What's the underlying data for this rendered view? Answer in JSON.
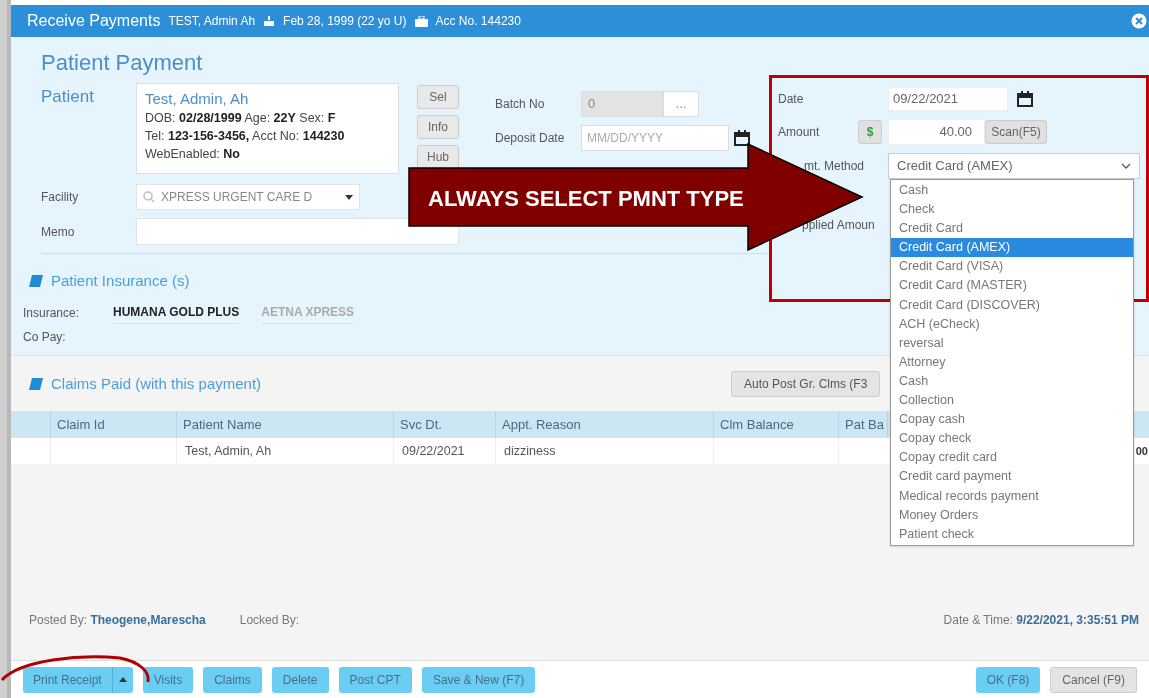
{
  "title_bar": {
    "title": "Receive Payments",
    "patient": "TEST, Admin Ah",
    "dob": "Feb 28, 1999 (22 yo U)",
    "account": "Acc No. 144230"
  },
  "heading": "Patient Payment",
  "patient": {
    "label": "Patient",
    "name": "Test, Admin, Ah",
    "lines": [
      "DOB: **02/28/1999** Age: **22Y** Sex: **F**",
      "Tel: **123-156-3456,** Acct No: **144230**",
      "WebEnabled:  **No**"
    ],
    "buttons": [
      "Sel",
      "Info",
      "Hub"
    ]
  },
  "batch": {
    "label": "Batch No",
    "value": "0",
    "button": "..."
  },
  "deposit_date": {
    "label": "Deposit Date",
    "placeholder": "MM/DD/YYYY"
  },
  "facility": {
    "label": "Facility",
    "value": "XPRESS URGENT CARE D"
  },
  "memo": {
    "label": "Memo"
  },
  "payment": {
    "date_label": "Date",
    "date": "09/22/2021",
    "amount_label": "Amount",
    "currency_button": "$",
    "amount": "40.00",
    "scan_button": "Scan(F5)",
    "method_label": "mt. Method",
    "method": "Credit Card (AMEX)",
    "unapplied_label": "pplied Amoun"
  },
  "method_options": [
    {
      "label": "Cash",
      "selected": false
    },
    {
      "label": "Check",
      "selected": false
    },
    {
      "label": "Credit Card",
      "selected": false
    },
    {
      "label": "Credit Card (AMEX)",
      "selected": true
    },
    {
      "label": "Credit Card (VISA)",
      "selected": false
    },
    {
      "label": "Credit Card (MASTER)",
      "selected": false
    },
    {
      "label": "Credit Card (DISCOVER)",
      "selected": false
    },
    {
      "label": "ACH (eCheck)",
      "selected": false
    },
    {
      "label": "reversal",
      "selected": false
    },
    {
      "label": "Attorney",
      "selected": false
    },
    {
      "label": "Cash",
      "selected": false
    },
    {
      "label": "Collection",
      "selected": false
    },
    {
      "label": "Copay cash",
      "selected": false
    },
    {
      "label": "Copay check",
      "selected": false
    },
    {
      "label": "Copay credit card",
      "selected": false
    },
    {
      "label": "Credit card payment",
      "selected": false
    },
    {
      "label": "Medical records payment",
      "selected": false
    },
    {
      "label": "Money Orders",
      "selected": false
    },
    {
      "label": "Patient check",
      "selected": false
    }
  ],
  "insurance": {
    "title": "Patient Insurance (s)",
    "insurance_label": "Insurance:",
    "plans": [
      {
        "name": "HUMANA GOLD PLUS",
        "primary": true
      },
      {
        "name": "AETNA XPRESS",
        "primary": false
      }
    ],
    "copay_label": "Co Pay:"
  },
  "claims": {
    "title": "Claims Paid (with this payment)",
    "auto_post_button": "Auto Post Gr. Clms (F3",
    "columns": [
      "Claim Id",
      "Patient Name",
      "Svc Dt.",
      "Appt. Reason",
      "Clm Balance",
      "Pat Ba"
    ],
    "rows": [
      {
        "patient_name": "Test, Admin, Ah",
        "svc_dt": "09/22/2021",
        "appt_reason": "dizziness",
        "column_8": "00"
      }
    ]
  },
  "footer": {
    "posted_by": "Posted By: **Theogene,Marescha**",
    "locked_by": "Locked By:",
    "date_time": "Date & Time: **9/22/2021, 3:35:51 PM**"
  },
  "buttons": [
    {
      "label": "Print Receipt",
      "kind": "split"
    },
    {
      "label": "Visits",
      "kind": "plain"
    },
    {
      "label": "Claims",
      "kind": "plain"
    },
    {
      "label": "Delete",
      "kind": "plain"
    },
    {
      "label": "Post CPT",
      "kind": "plain"
    },
    {
      "label": "Save & New (F7)",
      "kind": "plain"
    }
  ],
  "dialog_buttons": [
    {
      "label": "OK (F8)",
      "kind": "primary"
    },
    {
      "label": "Cancel (F9)",
      "kind": "secondary"
    }
  ],
  "annotation": {
    "text": "ALWAYS SELECT PMNT TYPE"
  }
}
